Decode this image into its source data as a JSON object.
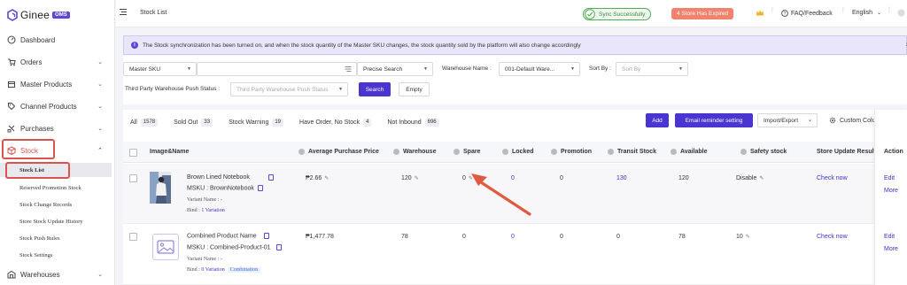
{
  "app": {
    "logo_text": "Ginee",
    "logo_badge": "OMS"
  },
  "sidebar": {
    "items": [
      {
        "label": "Dashboard",
        "icon": "dashboard-icon"
      },
      {
        "label": "Orders",
        "icon": "cart-icon"
      },
      {
        "label": "Master Products",
        "icon": "box-icon"
      },
      {
        "label": "Channel Products",
        "icon": "tag-icon"
      },
      {
        "label": "Purchases",
        "icon": "purchase-icon"
      },
      {
        "label": "Stock",
        "icon": "stock-icon"
      },
      {
        "label": "Warehouses",
        "icon": "warehouse-icon"
      }
    ],
    "stock_subitems": [
      {
        "label": "Stock List"
      },
      {
        "label": "Reserved Promotion Stock"
      },
      {
        "label": "Stock Change Records"
      },
      {
        "label": "Store Stock Update History"
      },
      {
        "label": "Stock Push Rules"
      },
      {
        "label": "Stock Settings"
      }
    ]
  },
  "header": {
    "page_title": "Stock List",
    "sync_status": "Sync Successfully",
    "store_expired": "4 Store Has Expired",
    "faq": "FAQ/Feedback",
    "language": "English"
  },
  "banner": {
    "text": "The Stock synchronization has been turned on, and when the stock quantity of the Master SKU changes, the stock quantity sold by the platform will also change accordingly"
  },
  "filters": {
    "search_type": "Master SKU",
    "search_value": "",
    "match_mode": "Precise Search",
    "warehouse_label": "Warehouse Name :",
    "warehouse_value": "001-Default Ware...",
    "sort_label": "Sort By :",
    "sort_placeholder": "Sort By",
    "push_status_label": "Third Party Warehouse Push Status :",
    "push_status_placeholder": "Third Party Warehouse Push Status",
    "search_button": "Search",
    "empty_button": "Empty"
  },
  "tabs": [
    {
      "label": "All",
      "count": "1578"
    },
    {
      "label": "Sold Out",
      "count": "33"
    },
    {
      "label": "Stock Warning",
      "count": "19"
    },
    {
      "label": "Have Order, No Stock",
      "count": "4"
    },
    {
      "label": "Not Inbound",
      "count": "696"
    }
  ],
  "actions": {
    "add": "Add",
    "email_reminder": "Email reminder setting",
    "import_export": "Import/Export",
    "custom_column": "Custom Column Setting"
  },
  "table": {
    "columns": [
      "Image&Name",
      "Average Purchase Price",
      "Warehouse",
      "Spare",
      "Locked",
      "Promotion",
      "Transit Stock",
      "Available",
      "Safety stock",
      "Store Update Result",
      "Action"
    ],
    "rows": [
      {
        "name": "Brown Lined Notebook",
        "msku": "MSKU : BrownNotebook",
        "variant": "Variant Name : -",
        "bind_prefix": "Bind :",
        "bind_link": "1 Variation",
        "bind_tag": "",
        "price": "₱2.66",
        "warehouse": "120",
        "spare": "0",
        "locked": "0",
        "promotion": "0",
        "transit": "130",
        "available": "120",
        "safety": "Disable",
        "store_update": "Check now",
        "action_edit": "Edit",
        "action_more": "More"
      },
      {
        "name": "Combined Product Name",
        "msku": "MSKU : Combined-Product-01",
        "variant": "Variant Name : -",
        "bind_prefix": "Bind :",
        "bind_link": "0 Variation",
        "bind_tag": "Combination",
        "price": "₱1,477.78",
        "warehouse": "78",
        "spare": "0",
        "locked": "0",
        "promotion": "0",
        "transit": "0",
        "available": "78",
        "safety": "10",
        "store_update": "Check now",
        "action_edit": "Edit",
        "action_more": "More"
      }
    ]
  },
  "colors": {
    "brand": "#4a35d0",
    "highlight": "#d9534f",
    "arrow": "#e05a3f",
    "link": "#3b30c9"
  }
}
